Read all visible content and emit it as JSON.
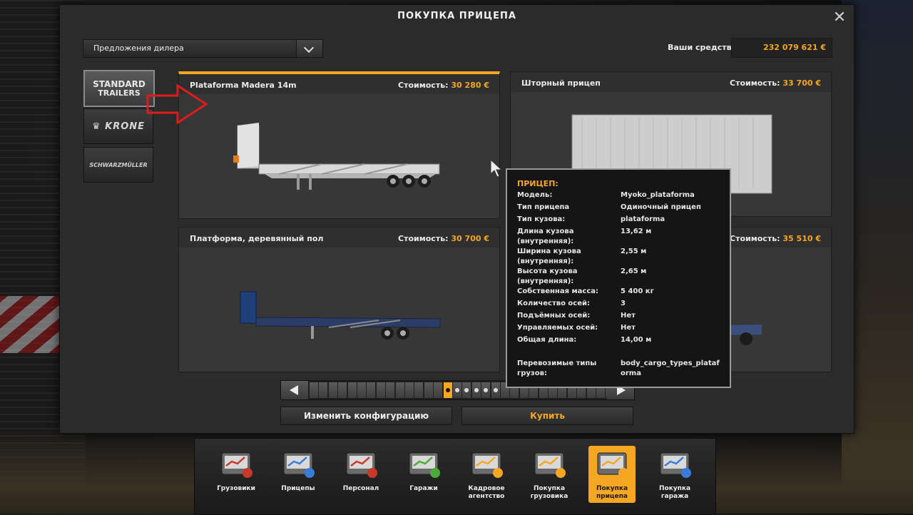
{
  "window": {
    "title": "ПОКУПКА ПРИЦЕПА"
  },
  "dealer": {
    "selected": "Предложения дилера"
  },
  "funds": {
    "label": "Ваши средства:",
    "value": "232 079 621 €"
  },
  "brands": [
    {
      "line1": "STANDARD",
      "line2": "TRAILERS"
    },
    {
      "line1": "KRONE"
    },
    {
      "line1": "SCHWARZMÜLLER"
    }
  ],
  "price_label": "Стоимость:",
  "cards": [
    {
      "name": "Plataforma Madera 14m",
      "price": "30 280 €"
    },
    {
      "name": "Шторный прицеп",
      "price": "33 700 €"
    },
    {
      "name": "Платформа, деревянный пол",
      "price": "30 700 €"
    },
    {
      "name": "",
      "price": "35 510 €"
    }
  ],
  "buttons": {
    "configure": "Изменить конфигурацию",
    "buy": "Купить"
  },
  "tooltip": {
    "title": "ПРИЦЕП:",
    "rows": [
      {
        "k": "Модель:",
        "v": "Myoko_plataforma"
      },
      {
        "k": "Тип прицепа",
        "v": "Одиночный прицеп"
      },
      {
        "k": "Тип кузова:",
        "v": "plataforma"
      },
      {
        "k": "Длина кузова (внутренняя):",
        "v": "13,62 м"
      },
      {
        "k": "Ширина кузова (внутренняя):",
        "v": "2,55 м"
      },
      {
        "k": "Высота кузова (внутренняя):",
        "v": "2,65 м"
      },
      {
        "k": "Собственная масса:",
        "v": "5 400 кг"
      },
      {
        "k": "Количество осей:",
        "v": "3"
      },
      {
        "k": "Подъёмных осей:",
        "v": "Нет"
      },
      {
        "k": "Управляемых осей:",
        "v": "Нет"
      },
      {
        "k": "Общая длина:",
        "v": "14,00 м"
      },
      {
        "k": "Перевозимые типы грузов:",
        "v": "body_cargo_types_plataforma"
      }
    ]
  },
  "dock": [
    {
      "label": "Грузовики",
      "icon": "trucks-icon"
    },
    {
      "label": "Прицепы",
      "icon": "trailers-icon"
    },
    {
      "label": "Персонал",
      "icon": "staff-icon"
    },
    {
      "label": "Гаражи",
      "icon": "garages-icon"
    },
    {
      "label": "Кадровое агентство",
      "icon": "recruitment-icon"
    },
    {
      "label": "Покупка грузовика",
      "icon": "buy-truck-icon"
    },
    {
      "label": "Покупка прицепа",
      "icon": "buy-trailer-icon",
      "selected": true
    },
    {
      "label": "Покупка гаража",
      "icon": "buy-garage-icon"
    }
  ],
  "colors": {
    "accent": "#f5a623",
    "panel": "#2b2b2b",
    "card": "#373737"
  }
}
